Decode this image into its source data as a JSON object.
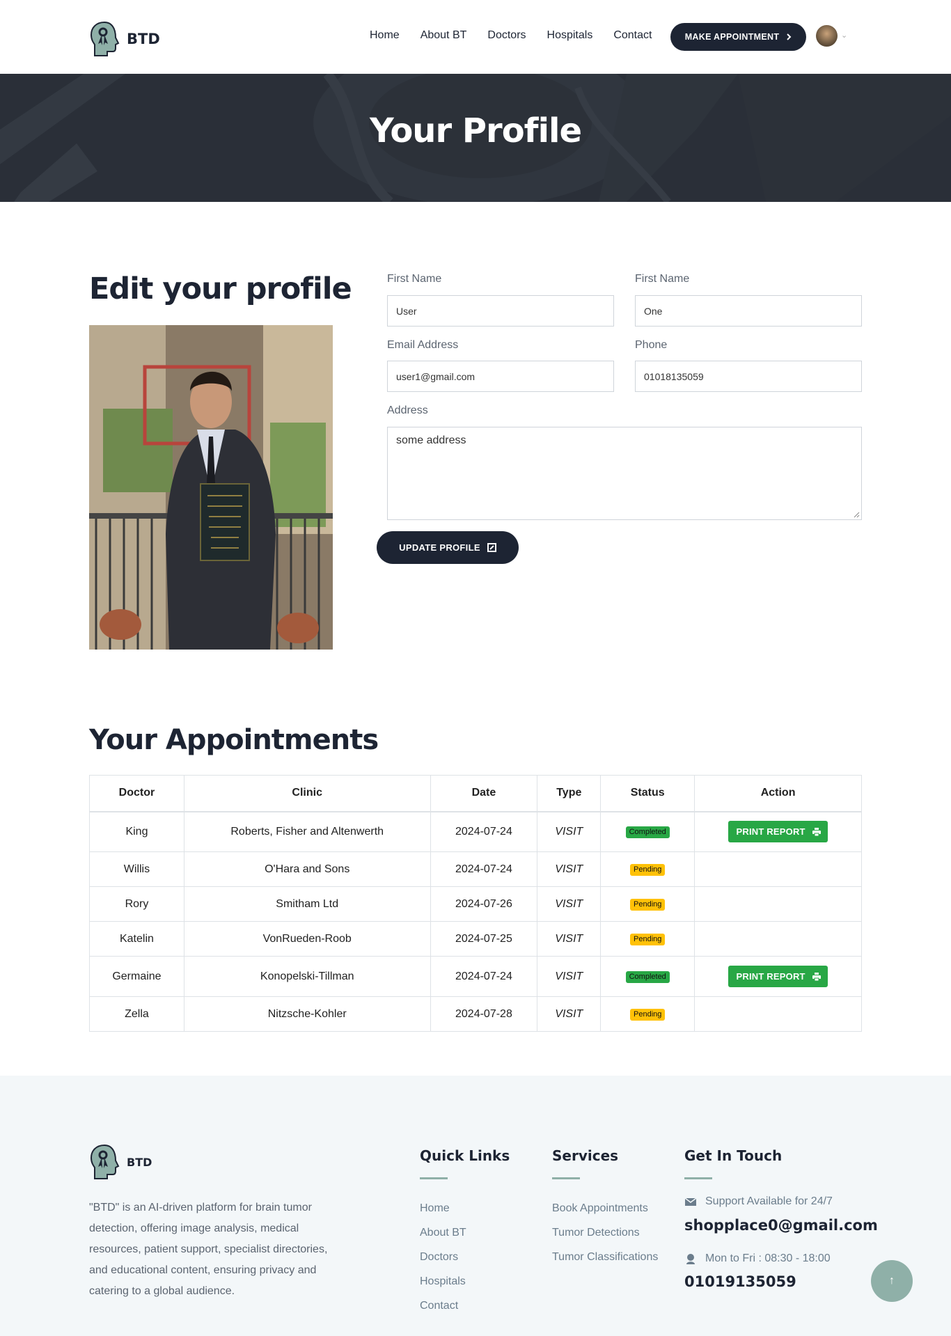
{
  "brand": {
    "name": "BTD"
  },
  "nav": {
    "items": [
      "Home",
      "About BT",
      "Doctors",
      "Hospitals",
      "Contact"
    ],
    "cta": "MAKE APPOINTMENT"
  },
  "banner": {
    "title": "Your Profile"
  },
  "profile": {
    "heading": "Edit your profile",
    "first_name_label": "First Name",
    "first_name_value": "User",
    "last_name_label": "First Name",
    "last_name_value": "One",
    "email_label": "Email Address",
    "email_value": "user1@gmail.com",
    "phone_label": "Phone",
    "phone_value": "01018135059",
    "address_label": "Address",
    "address_value": "some address",
    "update_button": "UPDATE PROFILE"
  },
  "appointments": {
    "heading": "Your Appointments",
    "columns": [
      "Doctor",
      "Clinic",
      "Date",
      "Type",
      "Status",
      "Action"
    ],
    "print_label": "PRINT REPORT",
    "rows": [
      {
        "doctor": "King",
        "clinic": "Roberts, Fisher and Altenwerth",
        "date": "2024-07-24",
        "type": "VISIT",
        "status": "Completed"
      },
      {
        "doctor": "Willis",
        "clinic": "O'Hara and Sons",
        "date": "2024-07-24",
        "type": "VISIT",
        "status": "Pending"
      },
      {
        "doctor": "Rory",
        "clinic": "Smitham Ltd",
        "date": "2024-07-26",
        "type": "VISIT",
        "status": "Pending"
      },
      {
        "doctor": "Katelin",
        "clinic": "VonRueden-Roob",
        "date": "2024-07-25",
        "type": "VISIT",
        "status": "Pending"
      },
      {
        "doctor": "Germaine",
        "clinic": "Konopelski-Tillman",
        "date": "2024-07-24",
        "type": "VISIT",
        "status": "Completed"
      },
      {
        "doctor": "Zella",
        "clinic": "Nitzsche-Kohler",
        "date": "2024-07-28",
        "type": "VISIT",
        "status": "Pending"
      }
    ]
  },
  "footer": {
    "brand": "BTD",
    "description": "\"BTD\" is an AI-driven platform for brain tumor detection, offering image analysis, medical resources, patient support, specialist directories, and educational content, ensuring privacy and catering to a global audience.",
    "quick_links_title": "Quick Links",
    "quick_links": [
      "Home",
      "About BT",
      "Doctors",
      "Hospitals",
      "Contact"
    ],
    "services_title": "Services",
    "services": [
      "Book Appointments",
      "Tumor Detections",
      "Tumor Classifications"
    ],
    "contact_title": "Get In Touch",
    "support_text": "Support Available for 24/7",
    "email": "shopplace0@gmail.com",
    "hours_text": "Mon to Fri : 08:30 - 18:00",
    "phone": "01019135059"
  },
  "colors": {
    "primary": "#1d2433",
    "success": "#28a745",
    "warning": "#ffc107",
    "accent": "#8fb0a8"
  },
  "icons": [
    "brain-ribbon-logo-icon",
    "chevron-right-icon",
    "chevron-down-icon",
    "edit-icon",
    "printer-icon",
    "mail-icon",
    "headset-icon",
    "arrow-up-icon"
  ]
}
